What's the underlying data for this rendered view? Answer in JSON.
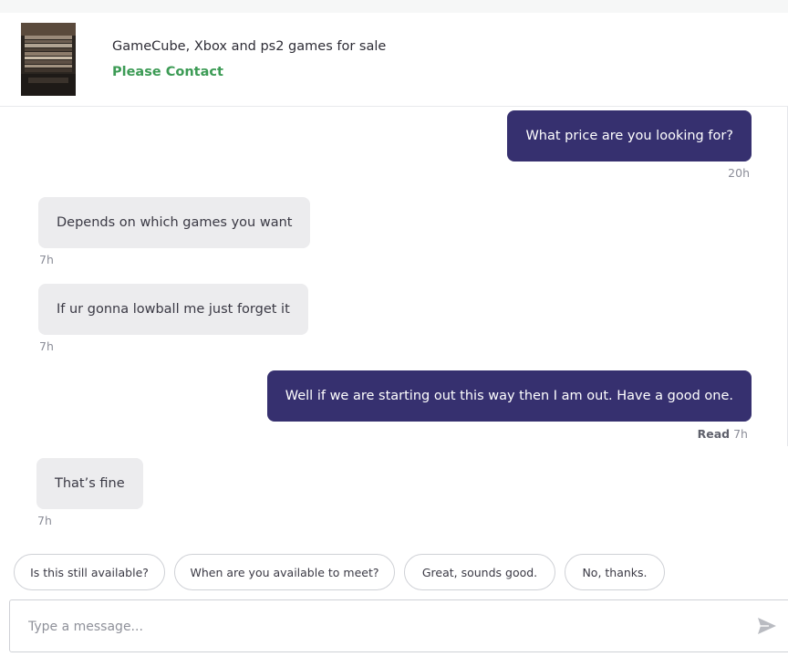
{
  "listing": {
    "title": "GameCube, Xbox and ps2 games for sale",
    "price_label": "Please Contact"
  },
  "messages": [
    {
      "direction": "outgoing",
      "text": "What price are you looking for?",
      "time": "20h"
    },
    {
      "direction": "incoming",
      "text": "Depends on which games you want",
      "time": "7h"
    },
    {
      "direction": "incoming",
      "text": "If ur gonna lowball me just forget it",
      "time": "7h"
    },
    {
      "direction": "outgoing",
      "text": "Well if we are starting out this way then I am out. Have a good one.",
      "read_label": "Read",
      "time": "7h"
    },
    {
      "direction": "incoming",
      "text": "That’s fine",
      "time": "7h"
    }
  ],
  "quick_replies": [
    "Is this still available?",
    "When are you available to meet?",
    "Great, sounds good.",
    "No, thanks."
  ],
  "composer": {
    "placeholder": "Type a message...",
    "send_icon": "send-icon"
  },
  "colors": {
    "outgoing_bubble": "#36306f",
    "incoming_bubble": "#ececee",
    "price_green": "#3c9b55"
  }
}
